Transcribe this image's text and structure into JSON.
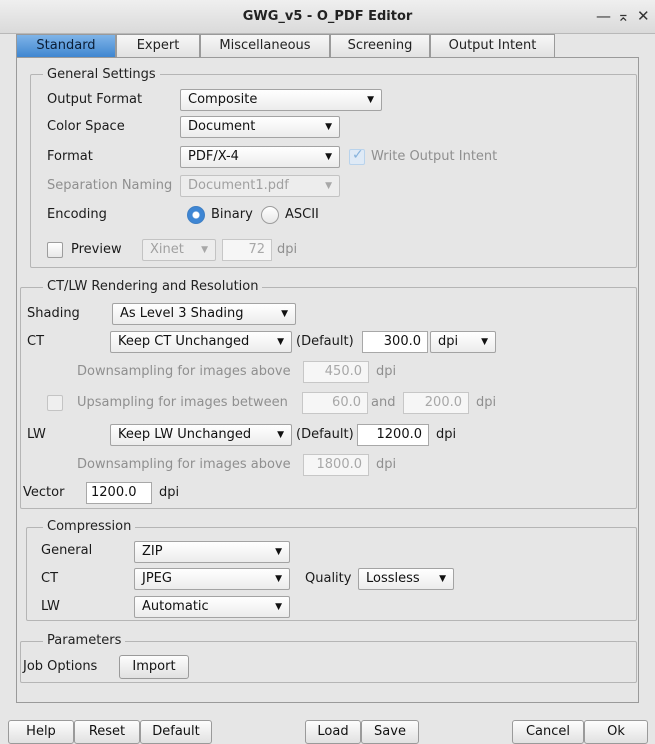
{
  "window": {
    "title": "GWG_v5 - O_PDF Editor",
    "controls": {
      "minimize": "—",
      "maximize": "⌅",
      "close": "✕"
    }
  },
  "tabs": [
    "Standard",
    "Expert",
    "Miscellaneous",
    "Screening",
    "Output Intent"
  ],
  "active_tab": "Standard",
  "general_settings": {
    "legend": "General Settings",
    "output_format": {
      "label": "Output Format",
      "value": "Composite"
    },
    "color_space": {
      "label": "Color Space",
      "value": "Document"
    },
    "format": {
      "label": "Format",
      "value": "PDF/X-4"
    },
    "write_output_intent": {
      "label": "Write Output Intent",
      "checked": true,
      "enabled": false
    },
    "separation_naming": {
      "label": "Separation Naming",
      "value": "Document1.pdf",
      "enabled": false
    },
    "encoding": {
      "label": "Encoding",
      "options": [
        "Binary",
        "ASCII"
      ],
      "selected": "Binary"
    },
    "preview": {
      "label": "Preview",
      "checked": false,
      "engine": "Xinet",
      "resolution": "72",
      "unit": "dpi"
    }
  },
  "rendering": {
    "legend": "CT/LW Rendering and Resolution",
    "shading": {
      "label": "Shading",
      "value": "As Level 3 Shading"
    },
    "ct": {
      "label": "CT",
      "mode": "Keep CT Unchanged",
      "default_label": "(Default)",
      "resolution": "300.0",
      "unit": "dpi"
    },
    "ct_downsampling": {
      "label": "Downsampling for images above",
      "value": "450.0",
      "unit": "dpi"
    },
    "ct_upsampling": {
      "label": "Upsampling for images between",
      "from": "60.0",
      "and_label": "and",
      "to": "200.0",
      "unit": "dpi",
      "checked": false
    },
    "lw": {
      "label": "LW",
      "mode": "Keep LW Unchanged",
      "default_label": "(Default)",
      "resolution": "1200.0",
      "unit": "dpi"
    },
    "lw_downsampling": {
      "label": "Downsampling for images above",
      "value": "1800.0",
      "unit": "dpi"
    },
    "vector": {
      "label": "Vector",
      "value": "1200.0",
      "unit": "dpi"
    }
  },
  "compression": {
    "legend": "Compression",
    "general": {
      "label": "General",
      "value": "ZIP"
    },
    "ct": {
      "label": "CT",
      "value": "JPEG"
    },
    "quality": {
      "label": "Quality",
      "value": "Lossless"
    },
    "lw": {
      "label": "LW",
      "value": "Automatic"
    }
  },
  "parameters": {
    "legend": "Parameters",
    "job_options_label": "Job Options",
    "import_label": "Import"
  },
  "footer": {
    "help": "Help",
    "reset": "Reset",
    "default": "Default",
    "load": "Load",
    "save": "Save",
    "cancel": "Cancel",
    "ok": "Ok"
  },
  "arrow_glyph": "▼"
}
